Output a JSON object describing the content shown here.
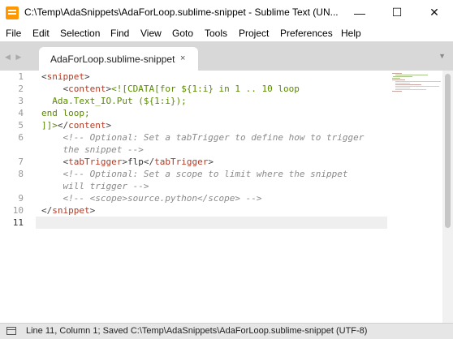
{
  "window": {
    "title": "C:\\Temp\\AdaSnippets\\AdaForLoop.sublime-snippet - Sublime Text (UN..."
  },
  "controls": {
    "minimize": "—",
    "maximize": "☐",
    "close": "✕"
  },
  "menu": [
    "File",
    "Edit",
    "Selection",
    "Find",
    "View",
    "Goto",
    "Tools",
    "Project",
    "Preferences",
    "Help"
  ],
  "tabs": [
    {
      "label": "AdaForLoop.sublime-snippet",
      "close": "×",
      "active": true
    }
  ],
  "tabbar": {
    "nav_arrows": "◀ ▶",
    "dropdown": "▼"
  },
  "editor": {
    "line_numbers": [
      "1",
      "2",
      "3",
      "4",
      "5",
      "6",
      "7",
      "8",
      "9",
      "10",
      "11"
    ],
    "lines": [
      {
        "num": "1",
        "segs": [
          {
            "t": "<",
            "c": "br"
          },
          {
            "t": "snippet",
            "c": "tg"
          },
          {
            "t": ">",
            "c": "br"
          }
        ]
      },
      {
        "segs": [
          {
            "t": "    <",
            "c": "br"
          },
          {
            "t": "content",
            "c": "tg"
          },
          {
            "t": ">",
            "c": "br"
          },
          {
            "t": "<![CDATA[for ${1:i} in 1 .. 10 loop",
            "c": "cd"
          }
        ]
      },
      {
        "segs": [
          {
            "t": "  Ada.Text_IO.Put (${1:i});",
            "c": "cd"
          }
        ]
      },
      {
        "segs": [
          {
            "t": "end loop;",
            "c": "cd"
          }
        ]
      },
      {
        "segs": [
          {
            "t": "]]>",
            "c": "cd"
          },
          {
            "t": "</",
            "c": "br"
          },
          {
            "t": "content",
            "c": "tg"
          },
          {
            "t": ">",
            "c": "br"
          }
        ]
      },
      {
        "segs": [
          {
            "t": "    <!-- Optional: Set a tabTrigger to define how to trigger",
            "c": "cm"
          }
        ]
      },
      {
        "segs": [
          {
            "t": "    the snippet -->",
            "c": "cm"
          }
        ]
      },
      {
        "segs": [
          {
            "t": "    <",
            "c": "br"
          },
          {
            "t": "tabTrigger",
            "c": "tg"
          },
          {
            "t": ">",
            "c": "br"
          },
          {
            "t": "flp",
            "c": ""
          },
          {
            "t": "</",
            "c": "br"
          },
          {
            "t": "tabTrigger",
            "c": "tg"
          },
          {
            "t": ">",
            "c": "br"
          }
        ]
      },
      {
        "segs": [
          {
            "t": "    <!-- Optional: Set a scope to limit where the snippet",
            "c": "cm"
          }
        ]
      },
      {
        "segs": [
          {
            "t": "    will trigger -->",
            "c": "cm"
          }
        ]
      },
      {
        "segs": [
          {
            "t": "    <!-- <scope>source.python</scope> -->",
            "c": "cm"
          }
        ]
      },
      {
        "segs": [
          {
            "t": "</",
            "c": "br"
          },
          {
            "t": "snippet",
            "c": "tg"
          },
          {
            "t": ">",
            "c": "br"
          }
        ]
      },
      {
        "segs": [
          {
            "t": "",
            "c": ""
          }
        ]
      }
    ]
  },
  "status": {
    "text": "Line 11, Column 1; Saved C:\\Temp\\AdaSnippets\\AdaForLoop.sublime-snippet (UTF-8)"
  },
  "colors": {
    "tag": "#b23b26",
    "cdata": "#5a8a00",
    "comment": "#8a8a8a",
    "current_line": "#efefef",
    "tabbar": "#d8d8d8",
    "statusbar": "#e6e6e6",
    "app_icon": "#ff9800"
  }
}
